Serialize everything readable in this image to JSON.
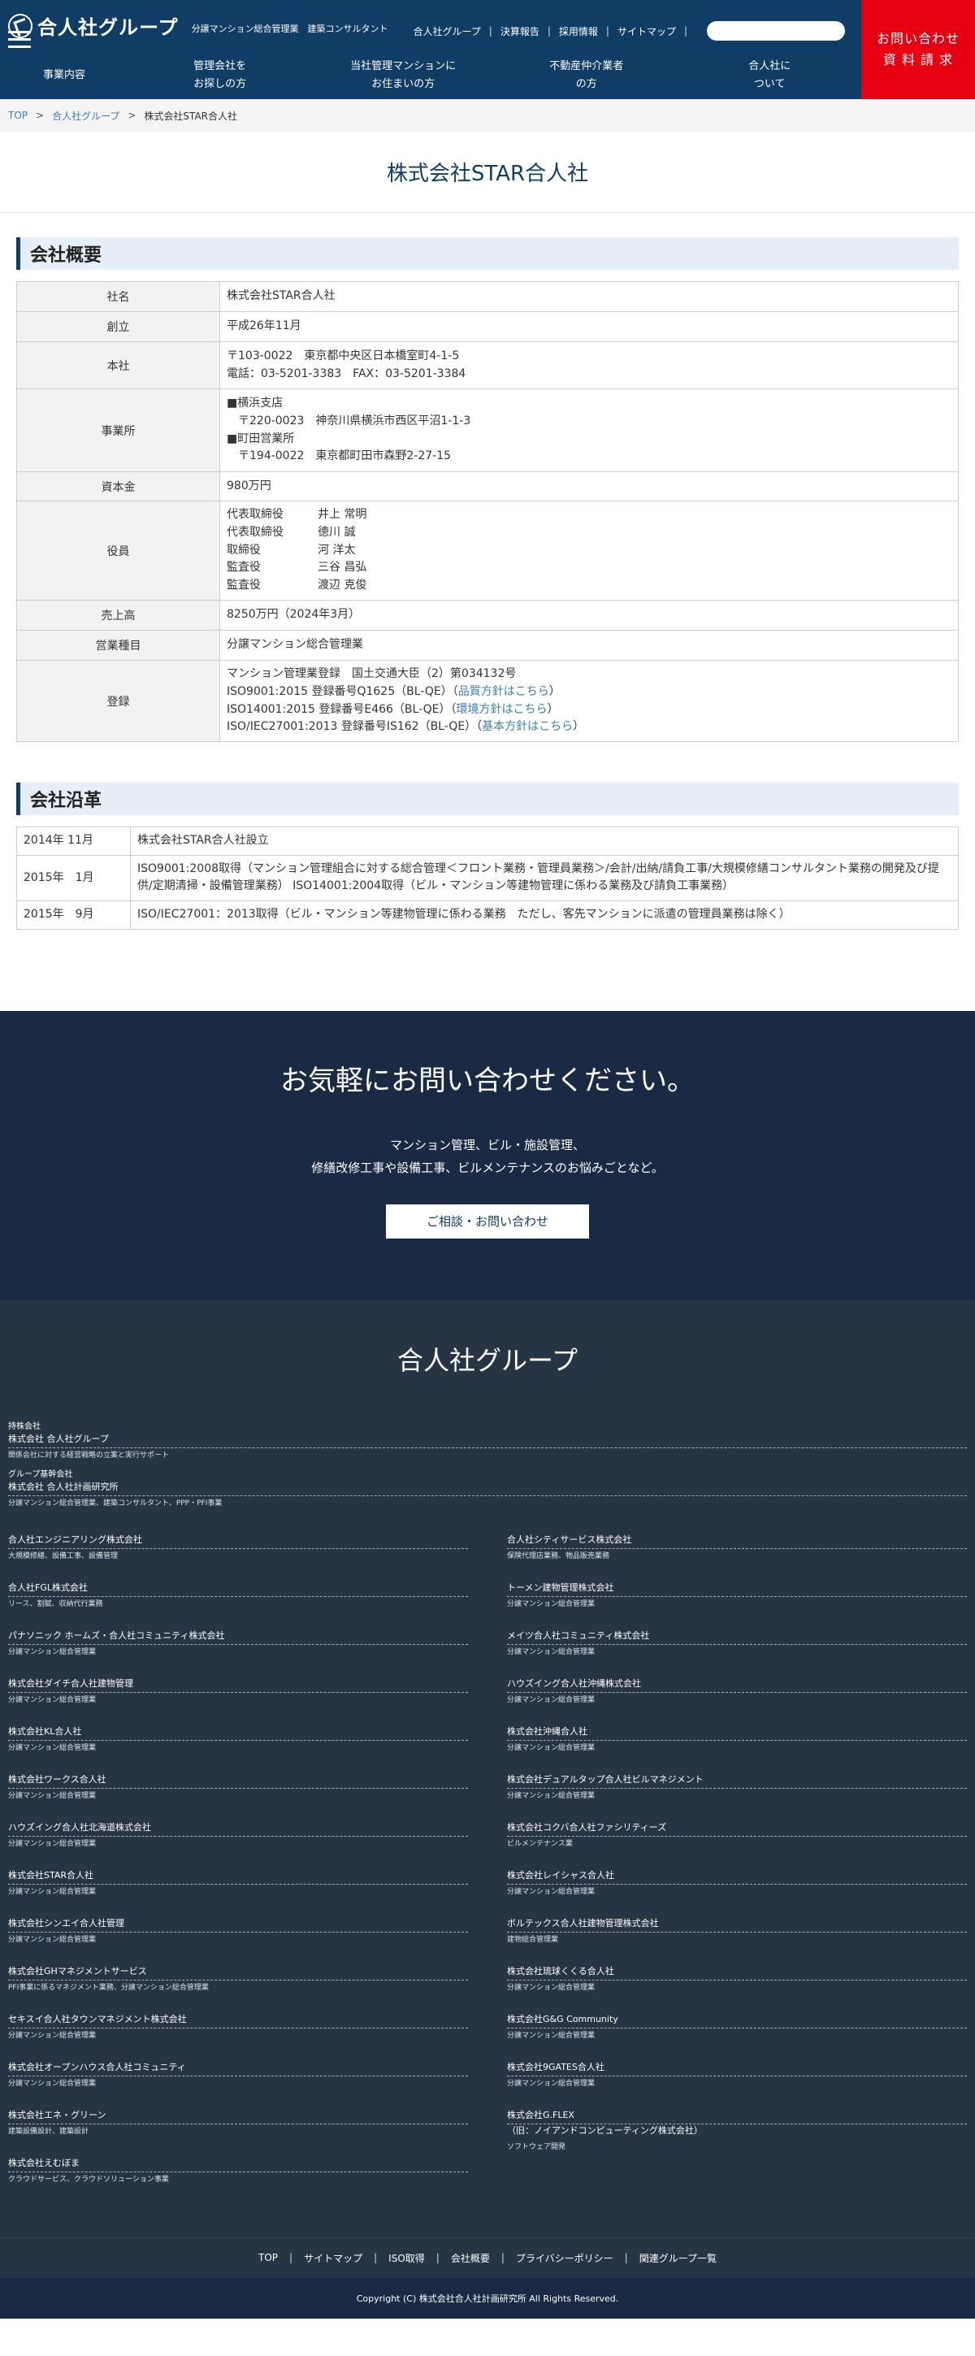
{
  "header": {
    "logo": "合人社グループ",
    "logo_sub": "分譲マンション総合管理業　建築コンサルタント",
    "top_links": [
      "合人社グループ",
      "決算報告",
      "採用情報",
      "サイトマップ"
    ],
    "cta": [
      "お問い合わせ",
      "資 料 請 求"
    ],
    "nav": [
      [
        "事業内容"
      ],
      [
        "管理会社を",
        "お探しの方"
      ],
      [
        "当社管理マンションに",
        "お住まいの方"
      ],
      [
        "不動産仲介業者",
        "の方"
      ],
      [
        "合人社に",
        "ついて"
      ]
    ]
  },
  "breadcrumb": {
    "top": "TOP",
    "group": "合人社グループ",
    "current": "株式会社STAR合人社"
  },
  "page_title": "株式会社STAR合人社",
  "overview": {
    "heading": "会社概要",
    "rows": [
      {
        "label": "社名",
        "value": "株式会社STAR合人社"
      },
      {
        "label": "創立",
        "value": "平成26年11月"
      },
      {
        "label": "本社",
        "value": "〒103-0022　東京都中央区日本橋室町4-1-5\n電話：03-5201-3383　FAX：03-5201-3384"
      },
      {
        "label": "事業所",
        "value": "■横浜支店\n　〒220-0023　神奈川県横浜市西区平沼1-1-3\n■町田営業所\n　〒194-0022　東京都町田市森野2-27-15"
      },
      {
        "label": "資本金",
        "value": "980万円"
      },
      {
        "label": "役員",
        "value": "代表取締役　　　井上 常明\n代表取締役　　　徳川 誠\n取締役　　　　　河 洋太\n監査役　　　　　三谷 昌弘\n監査役　　　　　渡辺 克俊"
      },
      {
        "label": "売上高",
        "value": "8250万円（2024年3月）"
      },
      {
        "label": "営業種目",
        "value": "分譲マンション総合管理業"
      }
    ],
    "registration": {
      "label": "登録",
      "line1": "マンション管理業登録　国土交通大臣（2）第034132号",
      "lines": [
        {
          "text": "ISO9001:2015 登録番号Q1625（BL-QE）（",
          "link": "品質方針はこちら",
          "end": "）"
        },
        {
          "text": "ISO14001:2015 登録番号E466（BL-QE）（",
          "link": "環境方針はこちら",
          "end": "）"
        },
        {
          "text": "ISO/IEC27001:2013 登録番号IS162（BL-QE）（",
          "link": "基本方針はこちら",
          "end": "）"
        }
      ]
    }
  },
  "history": {
    "heading": "会社沿革",
    "rows": [
      {
        "year": "2014年 11月",
        "text": "株式会社STAR合人社設立"
      },
      {
        "year": "2015年　1月",
        "text": "ISO9001:2008取得（マンション管理組合に対する総合管理＜フロント業務・管理員業務＞/会計/出納/請負工事/大規模修繕コンサルタント業務の開発及び提供/定期清掃・設備管理業務） ISO14001:2004取得（ビル・マンション等建物管理に係わる業務及び請負工事業務）"
      },
      {
        "year": "2015年　9月",
        "text": "ISO/IEC27001：2013取得（ビル・マンション等建物管理に係わる業務　ただし、客先マンションに派遣の管理員業務は除く）"
      }
    ]
  },
  "contact": {
    "title": "お気軽にお問い合わせください。",
    "line1": "マンション管理、ビル・施設管理、",
    "line2": "修繕改修工事や設備工事、ビルメンテナンスのお悩みごとなど。",
    "button": "ご相談・お問い合わせ"
  },
  "group": {
    "title": "合人社グループ",
    "top": [
      {
        "cat": "持株会社",
        "name": "株式会社 合人社グループ",
        "desc": "関係会社に対する経営戦略の立案と実行サポート"
      },
      {
        "cat": "グループ基幹会社",
        "name": "株式会社 合人社計画研究所",
        "desc": "分譲マンション総合管理業、建築コンサルタント、PPP・PFI事業"
      }
    ],
    "left": [
      {
        "name": "合人社エンジニアリング株式会社",
        "desc": "大規模修繕、設備工事、設備管理"
      },
      {
        "name": "合人社FGL株式会社",
        "desc": "リース、割賦、収納代行業務"
      },
      {
        "name": "パナソニック ホームズ・合人社コミュニティ株式会社",
        "desc": "分譲マンション総合管理業"
      },
      {
        "name": "株式会社ダイチ合人社建物管理",
        "desc": "分譲マンション総合管理業"
      },
      {
        "name": "株式会社KL合人社",
        "desc": "分譲マンション総合管理業"
      },
      {
        "name": "株式会社ワークス合人社",
        "desc": "分譲マンション総合管理業"
      },
      {
        "name": "ハウズイング合人社北海道株式会社",
        "desc": "分譲マンション総合管理業"
      },
      {
        "name": "株式会社STAR合人社",
        "desc": "分譲マンション総合管理業"
      },
      {
        "name": "株式会社シンエイ合人社管理",
        "desc": "分譲マンション総合管理業"
      },
      {
        "name": "株式会社GHマネジメントサービス",
        "desc": "PFI事業に係るマネジメント業務、分譲マンション総合管理業"
      },
      {
        "name": "セキスイ合人社タウンマネジメント株式会社",
        "desc": "分譲マンション総合管理業"
      },
      {
        "name": "株式会社オープンハウス合人社コミュニティ",
        "desc": "分譲マンション総合管理業"
      },
      {
        "name": "株式会社エネ・グリーン",
        "desc": "建築設備設計、建築設計"
      },
      {
        "name": "株式会社えむぼま",
        "desc": "クラウドサービス、クラウドソリューション事業"
      }
    ],
    "right": [
      {
        "name": "合人社シティサービス株式会社",
        "desc": "保険代理店業務、物品販売業務"
      },
      {
        "name": "トーメン建物管理株式会社",
        "desc": "分譲マンション総合管理業"
      },
      {
        "name": "メイツ合人社コミュニティ株式会社",
        "desc": "分譲マンション総合管理業"
      },
      {
        "name": "ハウズイング合人社沖縄株式会社",
        "desc": "分譲マンション総合管理業"
      },
      {
        "name": "株式会社沖縄合人社",
        "desc": "分譲マンション総合管理業"
      },
      {
        "name": "株式会社デュアルタップ合人社ビルマネジメント",
        "desc": "分譲マンション総合管理業"
      },
      {
        "name": "株式会社コクバ合人社ファシリティーズ",
        "desc": "ビルメンテナンス業"
      },
      {
        "name": "株式会社レイシャス合人社",
        "desc": "分譲マンション総合管理業"
      },
      {
        "name": "ボルテックス合人社建物管理株式会社",
        "desc": "建物総合管理業"
      },
      {
        "name": "株式会社琉球くくる合人社",
        "desc": "分譲マンション総合管理業"
      },
      {
        "name": "株式会社G&G Community",
        "desc": "分譲マンション総合管理業"
      },
      {
        "name": "株式会社9GATES合人社",
        "desc": "分譲マンション総合管理業"
      },
      {
        "name": "株式会社G.FLEX",
        "name2": "（旧：ノイアンドコンピューティング株式会社）",
        "desc": "ソフトウェア開発"
      }
    ]
  },
  "footer": {
    "links": [
      "TOP",
      "サイトマップ",
      "ISO取得",
      "会社概要",
      "プライバシーポリシー",
      "関連グループ一覧"
    ],
    "copyright": "Copyright (C) 株式会社合人社計画研究所 All Rights Reserved."
  }
}
